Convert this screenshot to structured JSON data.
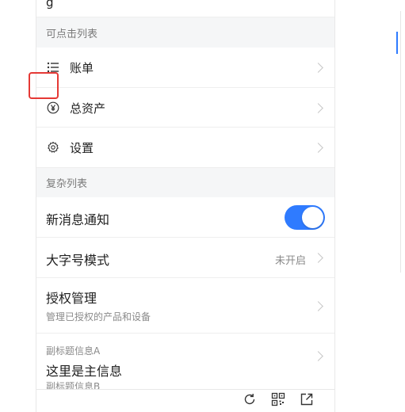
{
  "top_partial_text": "g",
  "sections": {
    "clickable": "可点击列表",
    "complex": "复杂列表"
  },
  "rows": {
    "bill": "账单",
    "assets": "总资产",
    "settings": "设置",
    "notification": "新消息通知",
    "large_font": "大字号模式",
    "large_font_status": "未开启",
    "auth": "授权管理",
    "auth_sub": "管理已授权的产品和设备",
    "info_top": "副标题信息A",
    "info_main": "这里是主信息",
    "info_bottom": "副标题信息B"
  },
  "notification_enabled": true,
  "colors": {
    "accent": "#2f7bff",
    "highlight": "#e53935"
  },
  "icons": [
    "list-icon",
    "yen-icon",
    "gear-icon",
    "refresh-icon",
    "qrcode-icon",
    "share-icon"
  ]
}
